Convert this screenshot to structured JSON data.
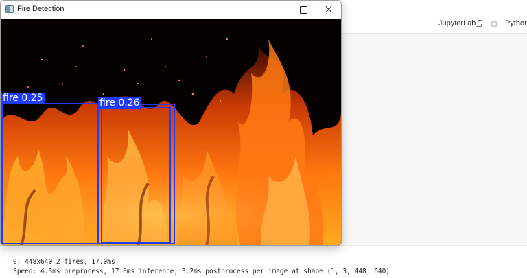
{
  "window": {
    "title": "Fire Detection"
  },
  "jupyter": {
    "link_label": "JupyterLab",
    "kernel_label": "Python"
  },
  "detections": [
    {
      "label": "fire 0.25",
      "class": "fire",
      "confidence": 0.25
    },
    {
      "label": "fire 0.26",
      "class": "fire",
      "confidence": 0.26
    }
  ],
  "output": {
    "line1": "0: 448x640 2 fires, 17.0ms",
    "line2": "Speed: 4.3ms preprocess, 17.0ms inference, 3.2ms postprocess per image at shape (1, 3, 448, 640)"
  },
  "colors": {
    "box": "#1f3bff",
    "label_text": "#ffffff"
  }
}
